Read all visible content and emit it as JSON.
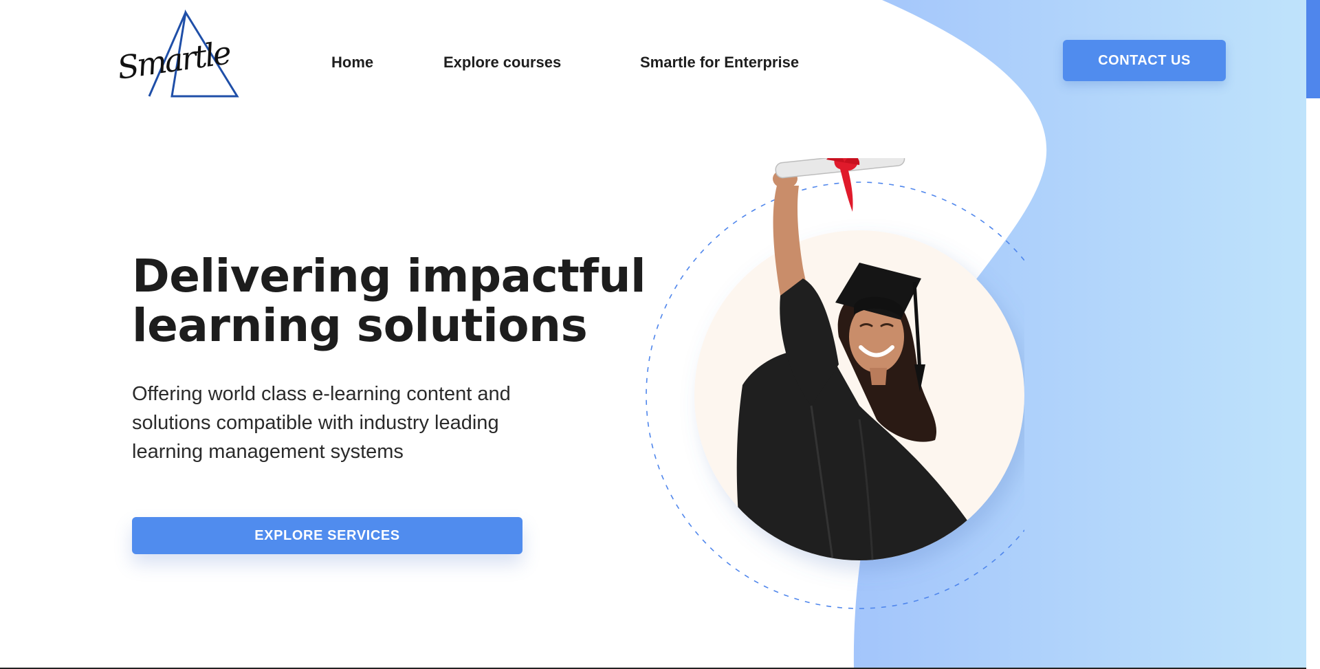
{
  "header": {
    "logo_text": "Smartle",
    "nav": [
      {
        "label": "Home"
      },
      {
        "label": "Explore courses"
      },
      {
        "label": "Smartle for Enterprise"
      }
    ],
    "contact_label": "CONTACT US"
  },
  "hero": {
    "headline_line1": "Delivering impactful",
    "headline_line2": "learning solutions",
    "subtext": "Offering world class e-learning content and solutions compatible with industry leading learning management systems",
    "cta_label": "EXPLORE SERVICES",
    "image": "graduate-celebrating-with-diploma"
  },
  "colors": {
    "accent": "#508cee",
    "blob_left": "#a3c5fb",
    "blob_right": "#bfe3fb",
    "text": "#1d1d1d",
    "circle_fill": "#fdf6ef",
    "gown": "#1f1f1f",
    "ribbon": "#e01a2b",
    "logo_triangle": "#1f4fa8"
  }
}
